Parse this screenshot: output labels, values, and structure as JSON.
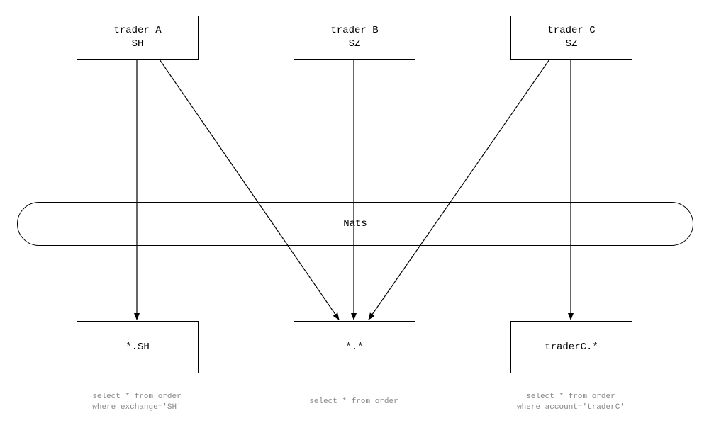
{
  "topNodes": [
    {
      "line1": "trader A",
      "line2": "SH"
    },
    {
      "line1": "trader B",
      "line2": "SZ"
    },
    {
      "line1": "trader C",
      "line2": "SZ"
    }
  ],
  "bus": {
    "label": "Nats"
  },
  "bottomNodes": [
    {
      "label": "*.SH"
    },
    {
      "label": "*.*"
    },
    {
      "label": "traderC.*"
    }
  ],
  "captions": [
    "select * from order\nwhere exchange='SH'",
    "select * from order",
    "select * from order\nwhere account='traderC'"
  ],
  "chart_data": {
    "type": "diagram",
    "title": "",
    "nodes": [
      {
        "id": "traderA",
        "label": "trader A\nSH",
        "layer": "top"
      },
      {
        "id": "traderB",
        "label": "trader B\nSZ",
        "layer": "top"
      },
      {
        "id": "traderC",
        "label": "trader C\nSZ",
        "layer": "top"
      },
      {
        "id": "nats",
        "label": "Nats",
        "layer": "bus"
      },
      {
        "id": "sub_sh",
        "label": "*.SH",
        "layer": "bottom",
        "query": "select * from order where exchange='SH'"
      },
      {
        "id": "sub_all",
        "label": "*.*",
        "layer": "bottom",
        "query": "select * from order"
      },
      {
        "id": "sub_c",
        "label": "traderC.*",
        "layer": "bottom",
        "query": "select * from order where account='traderC'"
      }
    ],
    "edges": [
      {
        "from": "traderA",
        "to": "sub_sh"
      },
      {
        "from": "traderA",
        "to": "sub_all"
      },
      {
        "from": "traderB",
        "to": "sub_all"
      },
      {
        "from": "traderC",
        "to": "sub_all"
      },
      {
        "from": "traderC",
        "to": "sub_c"
      }
    ]
  }
}
